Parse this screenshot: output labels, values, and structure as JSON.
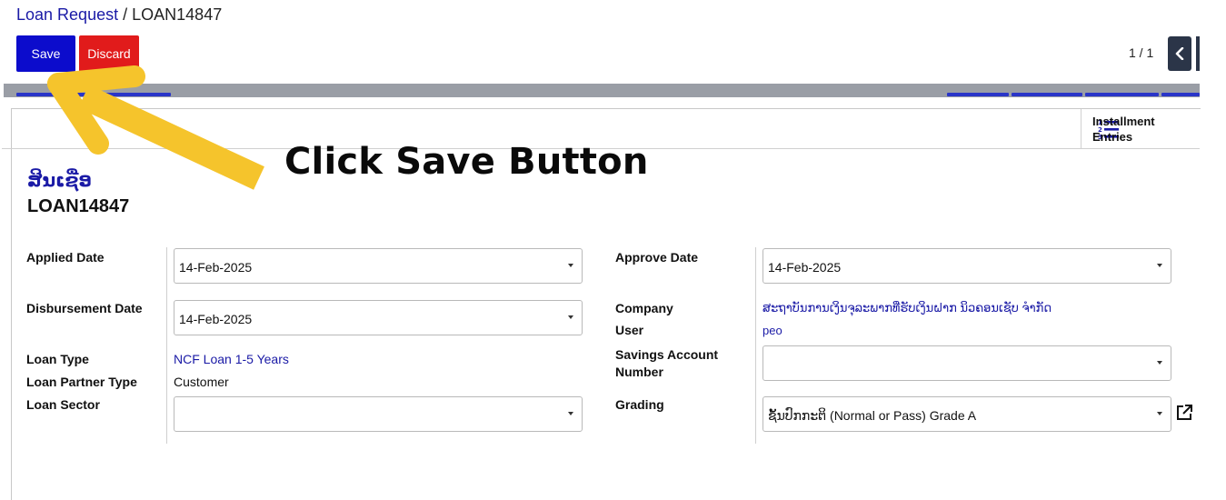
{
  "breadcrumb": {
    "parent": "Loan Request",
    "separator": "/",
    "current": "LOAN14847"
  },
  "toolbar": {
    "save_label": "Save",
    "discard_label": "Discard"
  },
  "pager": {
    "value": "1 / 1"
  },
  "smart_button": {
    "label_line1": "Installment",
    "label_line2": "Entries",
    "icon": "list-numbered-icon"
  },
  "annotation": {
    "text": "Click Save Button",
    "arrow_color": "#F5C42C"
  },
  "record": {
    "title_lao": "ສິນເຊື່ອ",
    "title_id": "LOAN14847"
  },
  "left": {
    "applied_date_label": "Applied Date",
    "applied_date_value": "14-Feb-2025",
    "disbursement_date_label": "Disbursement Date",
    "disbursement_date_value": "14-Feb-2025",
    "loan_type_label": "Loan Type",
    "loan_type_value": "NCF Loan 1-5 Years",
    "loan_partner_type_label": "Loan Partner Type",
    "loan_partner_type_value": "Customer",
    "loan_sector_label": "Loan Sector",
    "loan_sector_value": ""
  },
  "right": {
    "approve_date_label": "Approve Date",
    "approve_date_value": "14-Feb-2025",
    "company_label": "Company",
    "company_value": "ສະຖາບັນການເງິນຈຸລະພາກທີ່ຮັບເງິນຝາກ ນິວຄອນເຊັບ ຈຳກັດ",
    "user_label": "User",
    "user_value": "peo",
    "savings_account_label_line1": "Savings Account",
    "savings_account_label_line2": "Number",
    "savings_account_value": "",
    "grading_label": "Grading",
    "grading_value": "ຊັ້ນປົກກະຕິ  (Normal or Pass) Grade A"
  },
  "colors": {
    "primary": "#0C0CCC",
    "danger": "#E11B1B",
    "link": "#1A1AA6",
    "pager_bg": "#2B3548"
  }
}
